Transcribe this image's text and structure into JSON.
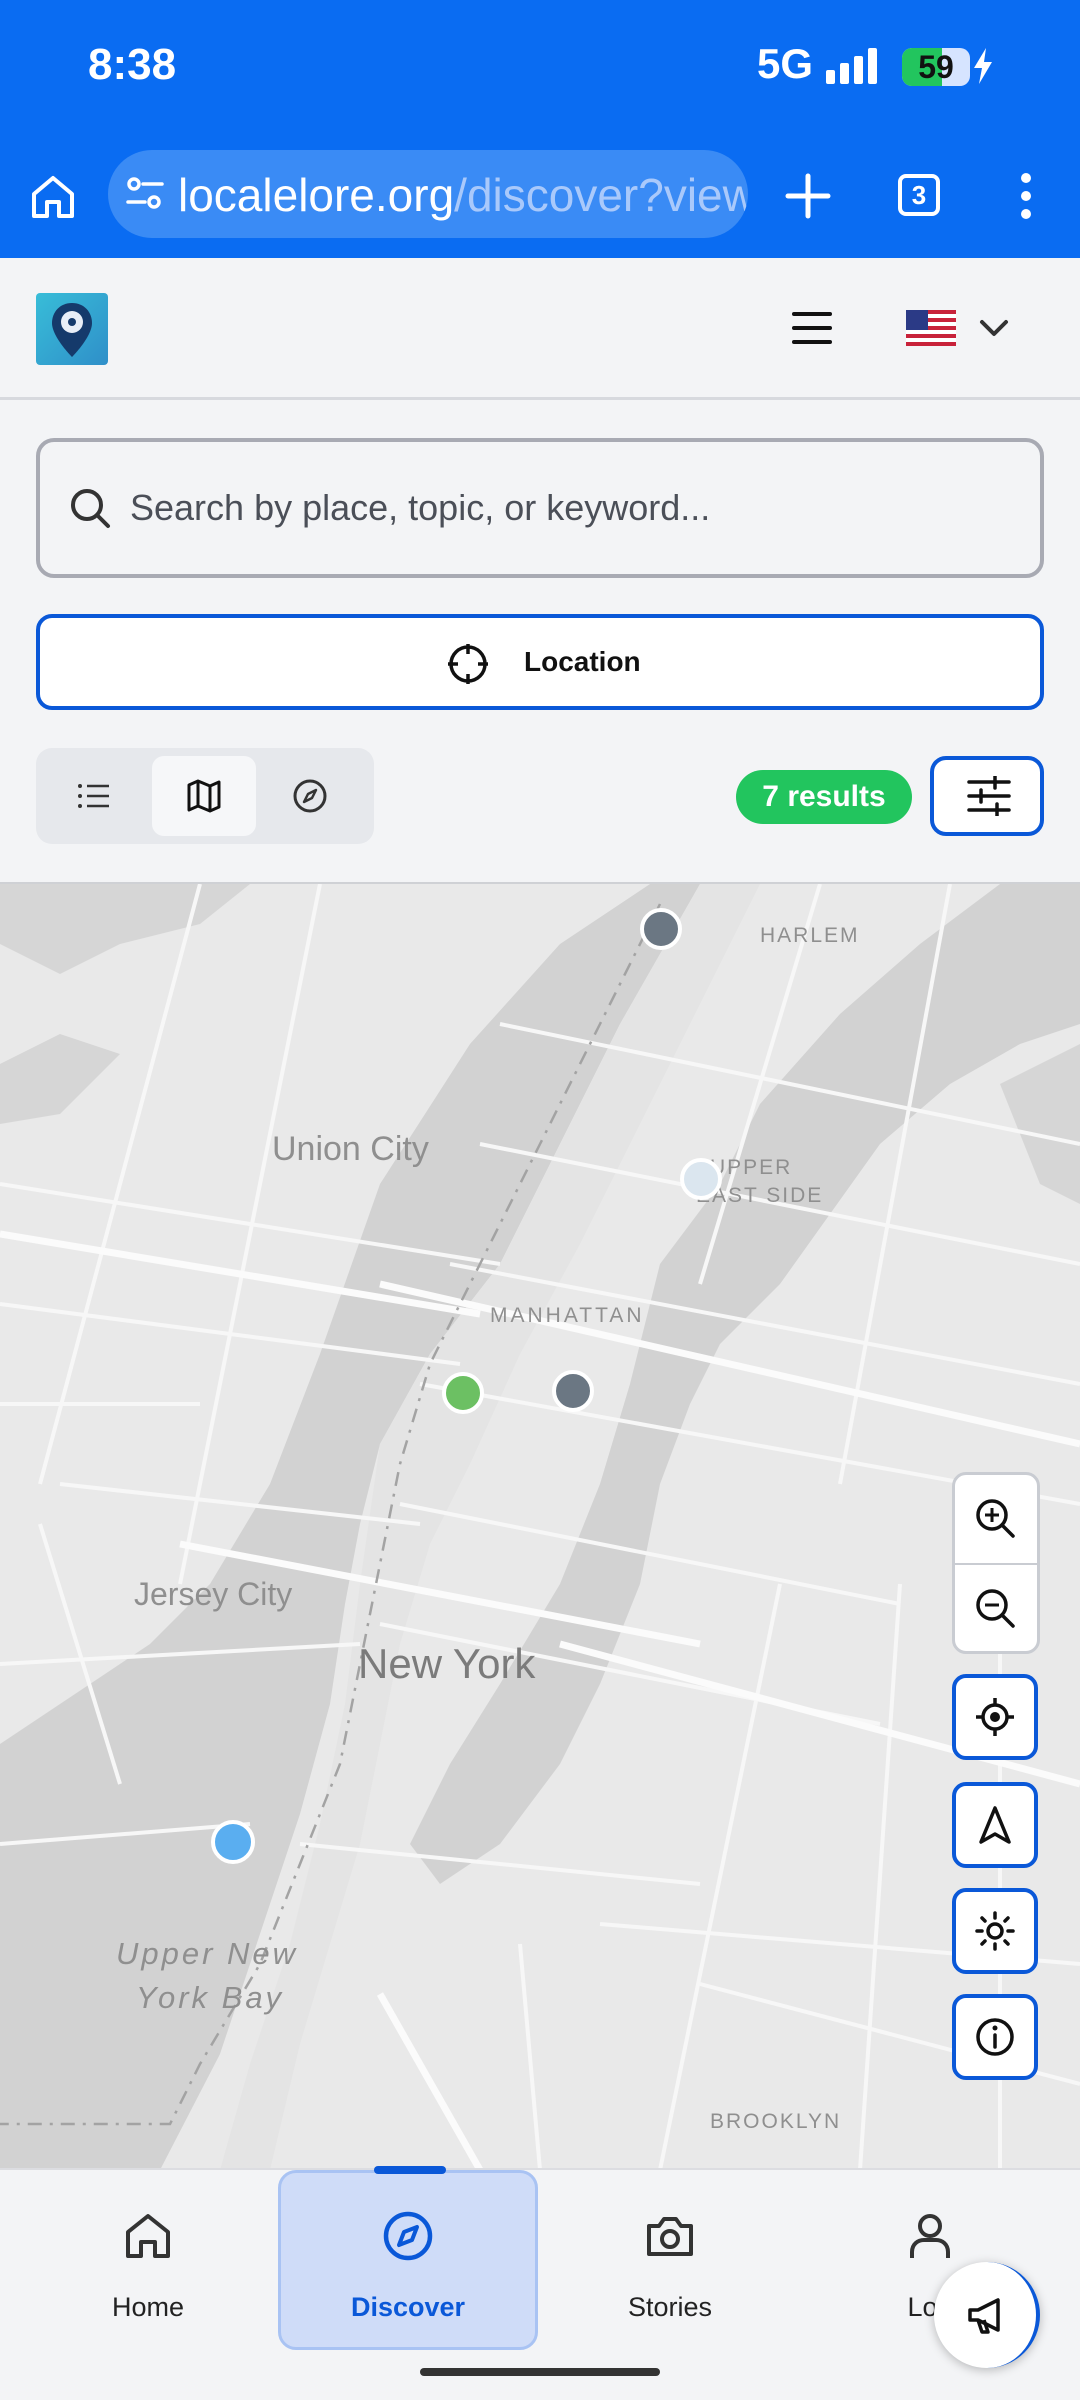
{
  "status_bar": {
    "time": "8:38",
    "network": "5G",
    "battery_pct": "59",
    "battery_level": 0.59
  },
  "browser": {
    "url_host": "localelore.org",
    "url_path": "/discover?view",
    "tab_count": "3"
  },
  "site_header": {
    "language_flag": "🇺🇸"
  },
  "search": {
    "placeholder": "Search by place, topic, or keyword..."
  },
  "location_button": {
    "label": "Location"
  },
  "view_toggle": {
    "views": [
      "list",
      "map",
      "compass"
    ],
    "selected": "map"
  },
  "results": {
    "label": "7 results"
  },
  "map": {
    "labels": {
      "harlem": "HARLEM",
      "union_city": "Union City",
      "upper_east_side_1": "UPPER",
      "upper_east_side_2": "EAST SIDE",
      "manhattan": "MANHATTAN",
      "jersey_city": "Jersey City",
      "new_york": "New York",
      "upper_ny_bay_1": "Upper New",
      "upper_ny_bay_2": "York Bay",
      "brooklyn": "BROOKLYN"
    },
    "pin_colors": {
      "gray": "#6b7783",
      "green": "#6cc063",
      "light": "#dbe6ef",
      "blue": "#5aaef0"
    }
  },
  "bottom_nav": {
    "items": [
      {
        "label": "Home",
        "icon": "home-icon"
      },
      {
        "label": "Discover",
        "icon": "compass-icon"
      },
      {
        "label": "Stories",
        "icon": "camera-icon"
      },
      {
        "label": "Log",
        "icon": "user-icon"
      }
    ],
    "active": "Discover"
  },
  "colors": {
    "brand_blue": "#0a6cf2",
    "accent_blue": "#0a58d8",
    "success_green": "#22c55e"
  }
}
